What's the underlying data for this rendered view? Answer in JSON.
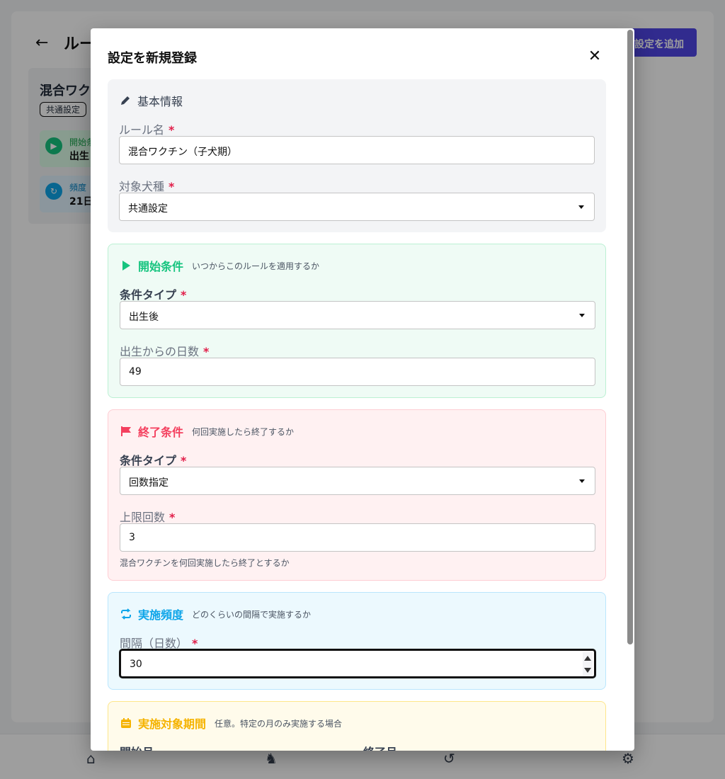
{
  "background": {
    "page_title": "ルー",
    "add_button_label": "設定を追加",
    "rule_card": {
      "name": "混合ワク",
      "badge": "共通設定",
      "start_label": "開始条",
      "start_value": "出生",
      "freq_label": "頻度",
      "freq_value": "21日"
    }
  },
  "modal": {
    "title": "設定を新規登録",
    "basic": {
      "title": "基本情報",
      "rule_name_label": "ルール名",
      "rule_name_value": "混合ワクチン（子犬期）",
      "breed_label": "対象犬種",
      "breed_value": "共通設定"
    },
    "start": {
      "title": "開始条件",
      "desc": "いつからこのルールを適用するか",
      "type_label": "条件タイプ",
      "type_value": "出生後",
      "days_label": "出生からの日数",
      "days_value": "49"
    },
    "end": {
      "title": "終了条件",
      "desc": "何回実施したら終了するか",
      "type_label": "条件タイプ",
      "type_value": "回数指定",
      "limit_label": "上限回数",
      "limit_value": "3",
      "helper": "混合ワクチンを何回実施したら終了とするか"
    },
    "frequency": {
      "title": "実施頻度",
      "desc": "どのくらいの間隔で実施するか",
      "interval_label": "間隔（日数）",
      "interval_value": "30"
    },
    "period": {
      "title": "実施対象期間",
      "desc": "任意。特定の月のみ実施する場合",
      "start_month_label": "開始月",
      "end_month_label": "終了月"
    },
    "required_mark": "*"
  },
  "colors": {
    "green": "#16c47f",
    "red": "#f43f5e",
    "blue": "#0ea5e9",
    "amber": "#f5b301",
    "indigo": "#4f46e5"
  },
  "icons": {
    "back": "arrow-left-icon",
    "close": "close-icon",
    "basic": "pencil-icon",
    "start": "play-icon",
    "end": "flag-icon",
    "frequency": "repeat-icon",
    "period": "calendar-icon",
    "nav": [
      "home-icon",
      "dog-icon",
      "history-icon",
      "gear-icon"
    ]
  }
}
